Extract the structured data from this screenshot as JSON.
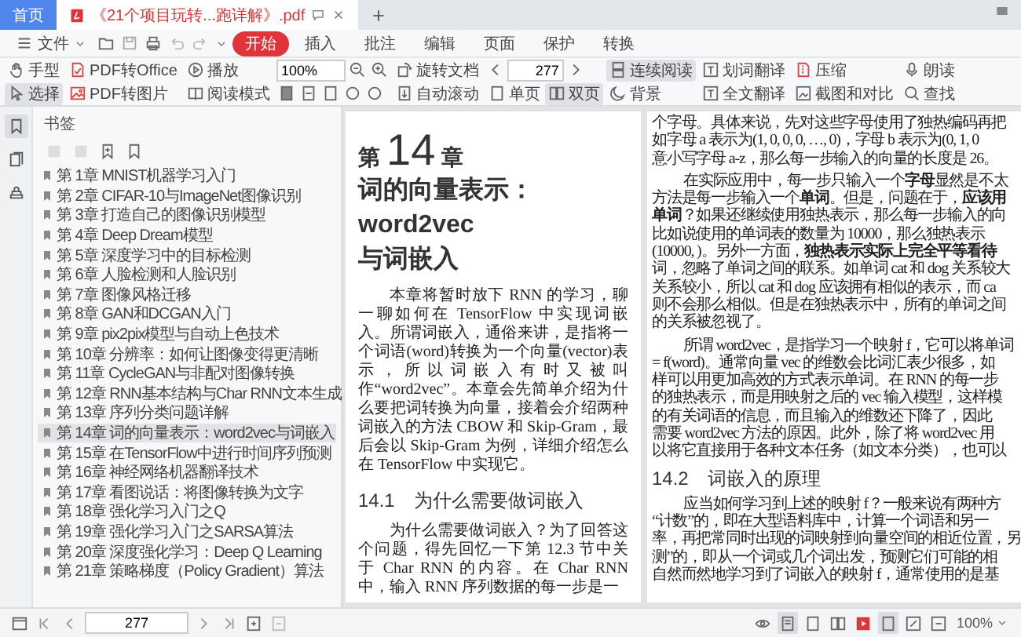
{
  "tabs": [
    {
      "label": "首页",
      "selected": false,
      "kind": "home"
    },
    {
      "label": "《21个项目玩转...跑详解》.pdf",
      "selected": true,
      "kind": "document"
    }
  ],
  "menu": {
    "file": "文件",
    "ribbon_tabs": [
      {
        "label": "开始",
        "selected": true
      },
      {
        "label": "插入",
        "selected": false
      },
      {
        "label": "批注",
        "selected": false
      },
      {
        "label": "编辑",
        "selected": false
      },
      {
        "label": "页面",
        "selected": false
      },
      {
        "label": "保护",
        "selected": false
      },
      {
        "label": "转换",
        "selected": false
      }
    ]
  },
  "toolbar": {
    "zoom": "100%",
    "page": "277",
    "tools": [
      {
        "label": "手型",
        "selected": false
      },
      {
        "label": "选择",
        "selected": true
      },
      {
        "label": "PDF转Office",
        "selected": false
      },
      {
        "label": "PDF转图片",
        "selected": false
      },
      {
        "label": "播放",
        "selected": false
      },
      {
        "label": "阅读模式",
        "selected": false
      },
      {
        "label": "旋转文档",
        "selected": false
      },
      {
        "label": "自动滚动",
        "selected": false
      },
      {
        "label": "单页",
        "selected": false
      },
      {
        "label": "双页",
        "selected": true
      },
      {
        "label": "连续阅读",
        "selected": true
      },
      {
        "label": "背景",
        "selected": false
      },
      {
        "label": "划词翻译",
        "selected": false
      },
      {
        "label": "全文翻译",
        "selected": false
      },
      {
        "label": "压缩",
        "selected": false
      },
      {
        "label": "截图和对比",
        "selected": false
      },
      {
        "label": "朗读",
        "selected": false
      },
      {
        "label": "查找",
        "selected": false
      }
    ]
  },
  "sidebar": {
    "title": "书签",
    "items": [
      {
        "label": "第 1章 MNIST机器学习入门",
        "selected": false
      },
      {
        "label": "第 2章 CIFAR-10与ImageNet图像识别",
        "selected": false
      },
      {
        "label": "第 3章 打造自己的图像识别模型",
        "selected": false
      },
      {
        "label": "第 4章 Deep Dream模型",
        "selected": false
      },
      {
        "label": "第 5章 深度学习中的目标检测",
        "selected": false
      },
      {
        "label": "第 6章 人脸检测和人脸识别",
        "selected": false
      },
      {
        "label": "第 7章 图像风格迁移",
        "selected": false
      },
      {
        "label": "第 8章 GAN和DCGAN入门",
        "selected": false
      },
      {
        "label": "第 9章 pix2pix模型与自动上色技术",
        "selected": false
      },
      {
        "label": "第 10章 分辨率：如何让图像变得更清晰",
        "selected": false
      },
      {
        "label": "第 11章 CycleGAN与非配对图像转换",
        "selected": false
      },
      {
        "label": "第 12章 RNN基本结构与Char RNN文本生成",
        "selected": false
      },
      {
        "label": "第 13章 序列分类问题详解",
        "selected": false
      },
      {
        "label": "第 14章 词的向量表示：word2vec与词嵌入",
        "selected": true
      },
      {
        "label": "第 15章 在TensorFlow中进行时间序列预测",
        "selected": false
      },
      {
        "label": "第 16章 神经网络机器翻译技术",
        "selected": false
      },
      {
        "label": "第 17章 看图说话：将图像转换为文字",
        "selected": false
      },
      {
        "label": "第 18章 强化学习入门之Q",
        "selected": false
      },
      {
        "label": "第 19章 强化学习入门之SARSA算法",
        "selected": false
      },
      {
        "label": "第 20章 深度强化学习：Deep Q Learning",
        "selected": false
      },
      {
        "label": "第 21章 策略梯度（Policy Gradient）算法",
        "selected": false
      }
    ]
  },
  "left_page": {
    "chapter_prefix": "第",
    "chapter_number": "14",
    "chapter_suffix": "章",
    "title_lines": [
      "词的向量表示：word2vec",
      "与词嵌入"
    ],
    "blocks": [
      {
        "kind": "paragraph",
        "text": "本章将暂时放下 RNN 的学习，聊一聊如何在 TensorFlow 中实现词嵌入。所谓词嵌入，通俗来讲，是指将一个词语(word)转换为一个向量(vector)表示，所以词嵌入有时又被叫作“word2vec”。本章会先简单介绍为什么要把词转换为向量，接着会介绍两种词嵌入的方法 CBOW 和 Skip-Gram，最后会以 Skip-Gram 为例，详细介绍怎么在 TensorFlow 中实现它。"
      },
      {
        "kind": "heading",
        "text": "14.1　为什么需要做词嵌入"
      },
      {
        "kind": "paragraph",
        "text": "为什么需要做词嵌入？为了回答这个问题，得先回忆一下第 12.3 节中关于 Char RNN 的内容。在 Char RNN 中，输入 RNN 序列数据的每一步是一"
      }
    ]
  },
  "right_page": {
    "blocks": [
      {
        "kind": "paragraph",
        "continued": true,
        "lines": [
          "个字母。具体来说，先对这些字母使用了独热编码再把",
          "如字母 a 表示为(1, 0, 0, 0, …, 0)，字母 b 表示为(0, 1, 0",
          "意小写字母 a-z，那么每一步输入的向量的长度是 26。"
        ]
      },
      {
        "kind": "paragraph",
        "continued": false,
        "lines": [
          "在实际应用中，每一步只输入一个**字母**显然是不太",
          "方法是每一步输入一个**单词**。但是，问题在于，**应该用**",
          "**单词**？如果还继续使用独热表示，那么每一步输入的向",
          "比如说使用的单词表的数量为 10000，那么独热表示",
          "(10000, )。另外一方面，**独热表示实际上完全平等看待**",
          "词，忽略了单词之间的联系。如单词 cat 和 dog 关系较大",
          "关系较小，所以 cat 和 dog 应该拥有相似的表示，而 ca",
          "则不会那么相似。但是在独热表示中，所有的单词之间",
          "的关系被忽视了。"
        ]
      },
      {
        "kind": "paragraph",
        "continued": false,
        "lines": [
          "所谓 word2vec，是指学习一个映射 f，它可以将单词",
          "= f(word)。通常向量 vec 的维数会比词汇表少很多，如",
          "样可以用更加高效的方式表示单词。在 RNN 的每一步",
          "的独热表示，而是用映射之后的 vec 输入模型，这样模",
          "的有关词语的信息，而且输入的维数还下降了，因此",
          "需要 word2vec 方法的原因。此外，除了将 word2vec 用",
          "以将它直接用于各种文本任务（如文本分类），也可以"
        ]
      },
      {
        "kind": "heading",
        "lines": [
          "14.2　词嵌入的原理"
        ]
      },
      {
        "kind": "paragraph",
        "continued": false,
        "lines": [
          "应当如何学习到上述的映射 f？一般来说有两种方",
          "“计数”的，即在大型语料库中，计算一个词语和另一",
          "率，再把常同时出现的词映射到向量空间的相近位置，另",
          "测”的，即从一个词或几个词出发，预测它们可能的相",
          "自然而然地学习到了词嵌入的映射 f，通常使用的是基"
        ]
      }
    ]
  },
  "status_bar": {
    "page": "277",
    "zoom": "100%"
  }
}
